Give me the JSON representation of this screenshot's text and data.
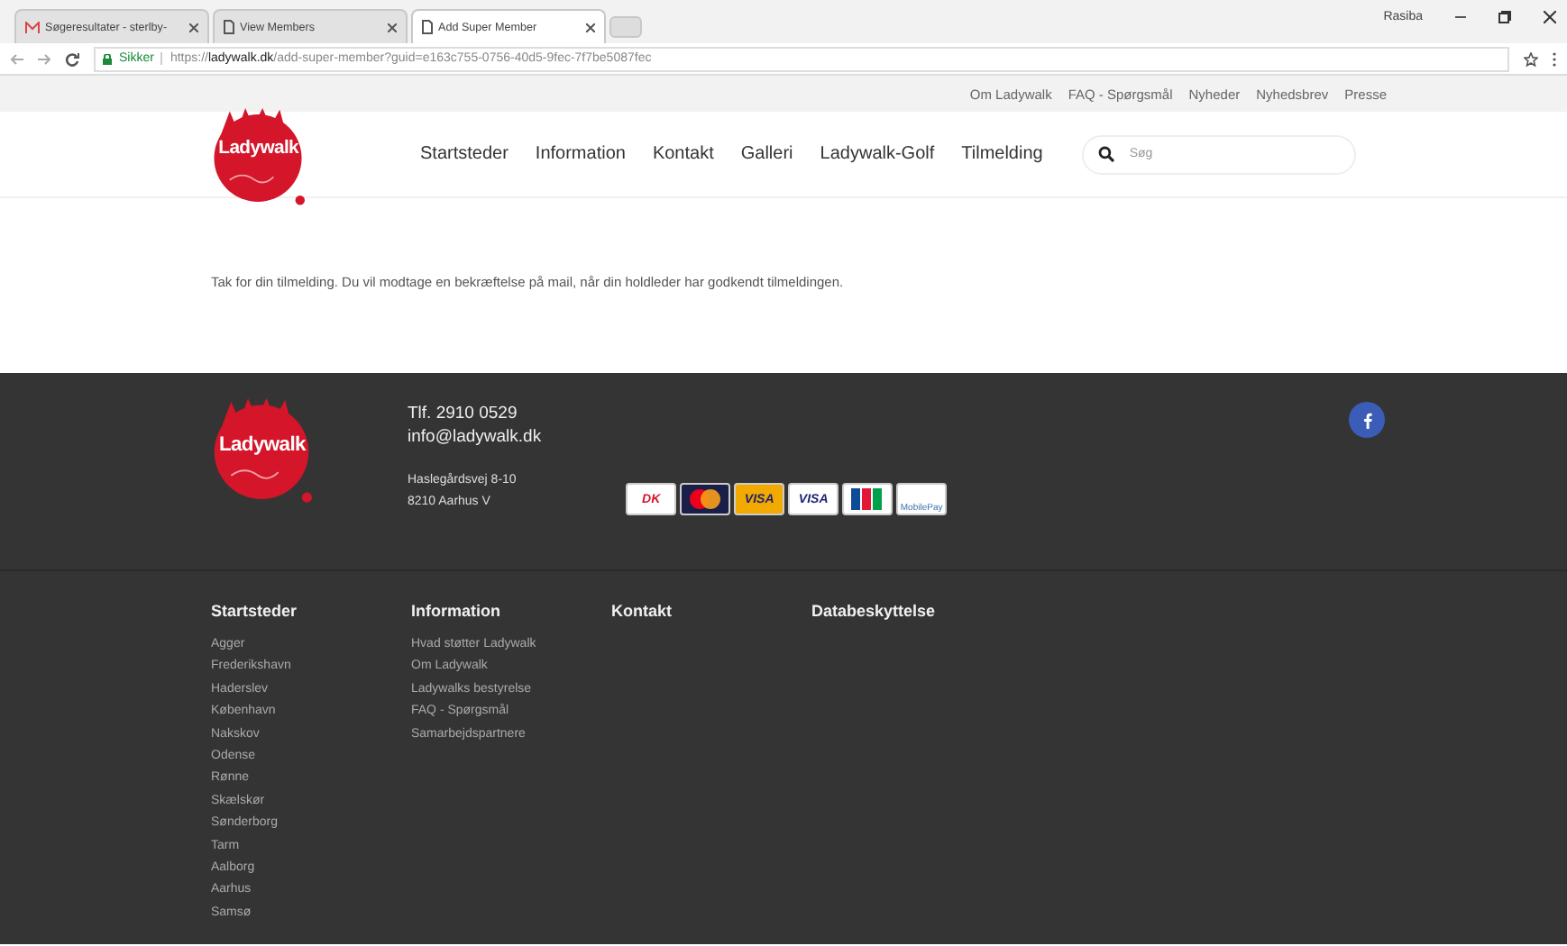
{
  "browser": {
    "tabs": [
      {
        "kind": "mail",
        "title": "Søgeresultater - sterlby-",
        "selected": false
      },
      {
        "kind": "page",
        "title": "View Members",
        "selected": false
      },
      {
        "kind": "page",
        "title": "Add Super Member",
        "selected": true
      }
    ],
    "profile": "Rasiba",
    "address": {
      "secure_label": "Sikker",
      "scheme": "https://",
      "domain": "ladywalk.dk",
      "path": "/add-super-member?guid=e163c755-0756-40d5-9fec-7f7be5087fec"
    }
  },
  "top_links": [
    "Om Ladywalk",
    "FAQ - Spørgsmål",
    "Nyheder",
    "Nyhedsbrev",
    "Presse"
  ],
  "header": {
    "logo_text": "Ladywalk",
    "nav": [
      "Startsteder",
      "Information",
      "Kontakt",
      "Galleri",
      "Ladywalk-Golf",
      "Tilmelding"
    ],
    "search": {
      "placeholder": "Søg"
    }
  },
  "message": "Tak for din tilmelding. Du vil modtage en bekræftelse på mail, når din holdleder har godkendt tilmeldingen.",
  "footer": {
    "logo_text": "Ladywalk",
    "phone": "Tlf. 2910 0529",
    "email": "info@ladywalk.dk",
    "address": [
      "Haslegårdsvej 8-10",
      "8210 Aarhus V"
    ],
    "cards": [
      {
        "kind": "dk",
        "label": "DK"
      },
      {
        "kind": "mastercard"
      },
      {
        "kind": "visa",
        "label": "VISA"
      },
      {
        "kind": "visa-electron",
        "label": "VISA"
      },
      {
        "kind": "jcb"
      },
      {
        "kind": "mobilepay",
        "label": "MobilePay"
      }
    ],
    "columns": [
      {
        "heading": "Startsteder",
        "links": [
          "Agger",
          "Frederikshavn",
          "Haderslev",
          "København",
          "Nakskov",
          "Odense",
          "Rønne",
          "Skælskør",
          "Sønderborg",
          "Tarm",
          "Aalborg",
          "Aarhus",
          "Samsø"
        ]
      },
      {
        "heading": "Information",
        "links": [
          "Hvad støtter Ladywalk",
          "Om Ladywalk",
          "Ladywalks bestyrelse",
          "FAQ - Spørgsmål",
          "Samarbejdspartnere"
        ]
      },
      {
        "heading": "Kontakt"
      },
      {
        "heading": "Databeskyttelse"
      }
    ]
  }
}
